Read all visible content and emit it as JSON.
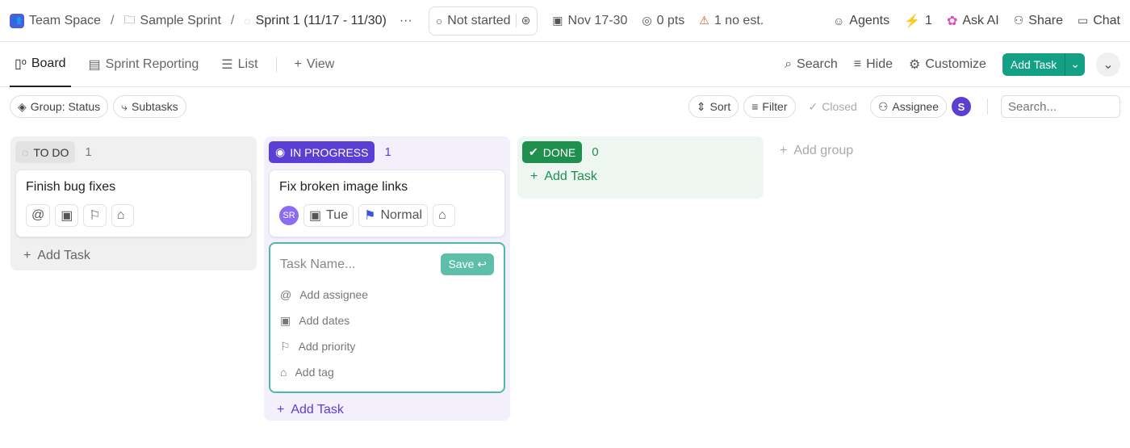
{
  "breadcrumb": {
    "space": "Team Space",
    "folder": "Sample Sprint",
    "sprint": "Sprint 1 (11/17 - 11/30)"
  },
  "status": "Not started",
  "meta": {
    "dates": "Nov 17-30",
    "points": "0 pts",
    "estimate": "1 no est."
  },
  "top_actions": {
    "agents": "Agents",
    "bolt_count": "1",
    "ask_ai": "Ask AI",
    "share": "Share",
    "chat": "Chat"
  },
  "tabs": [
    {
      "label": "Board"
    },
    {
      "label": "Sprint Reporting"
    },
    {
      "label": "List"
    },
    {
      "label": "View"
    }
  ],
  "view_actions": {
    "search": "Search",
    "hide": "Hide",
    "customize": "Customize",
    "add_task": "Add Task"
  },
  "filters": {
    "group": "Group: Status",
    "subtasks": "Subtasks",
    "sort": "Sort",
    "filter": "Filter",
    "closed": "Closed",
    "assignee": "Assignee",
    "avatar": "S",
    "search_placeholder": "Search..."
  },
  "columns": [
    {
      "name": "TO DO",
      "count": "1",
      "color": "#e8e8e8",
      "tasks": [
        {
          "title": "Finish bug fixes"
        }
      ],
      "add": "Add Task"
    },
    {
      "name": "IN PROGRESS",
      "count": "1",
      "color": "#5b3fd4",
      "tasks": [
        {
          "title": "Fix broken image links",
          "assignee": "SR",
          "due": "Tue",
          "priority": "Normal"
        }
      ],
      "add": "Add Task"
    },
    {
      "name": "DONE",
      "count": "0",
      "color": "#1f8f4e",
      "add": "Add Task"
    }
  ],
  "new_task": {
    "placeholder": "Task Name...",
    "save": "Save",
    "assignee": "Add assignee",
    "dates": "Add dates",
    "priority": "Add priority",
    "tag": "Add tag"
  },
  "add_group": "Add group"
}
